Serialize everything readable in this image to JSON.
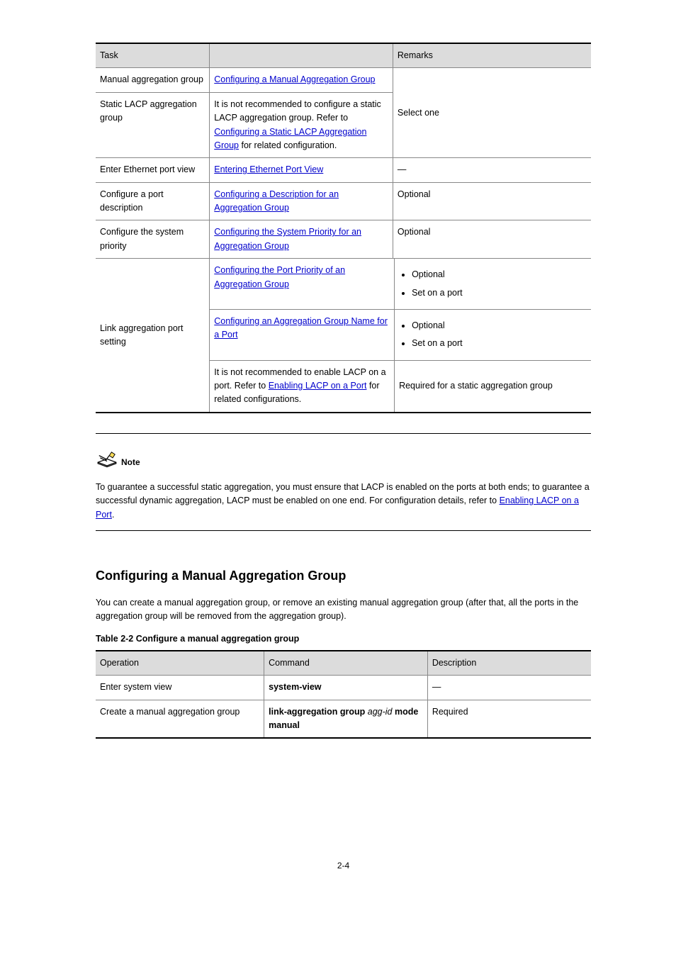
{
  "table1": {
    "headers": [
      "Task",
      "Remarks",
      ""
    ],
    "col_widths": [
      "23%",
      "37%",
      "40%"
    ],
    "rows": [
      {
        "task": "Manual aggregation group",
        "config_ref_text": "Configuring a Manual Aggregation Group",
        "after_link": "",
        "remarks": "Select one"
      },
      {
        "task": "Static LACP aggregation group",
        "pre": "It is not recommended to configure a static LACP aggregation group. Refer to ",
        "config_ref_text": "Configuring a Static LACP Aggregation Group",
        "after_link": " for related configuration.",
        "remarks": "Select one"
      },
      {
        "task": "Enter Ethernet port view",
        "config_ref_text": "Entering Ethernet Port View",
        "after_link": "",
        "remarks": "—"
      },
      {
        "task": "Configure a port description",
        "config_ref_text": "Configuring a Description for an Aggregation Group",
        "after_link": "",
        "remarks": "Optional"
      },
      {
        "task": "Configure the system priority",
        "config_ref_text": "Configuring the System Priority for an Aggregation Group",
        "after_link": "",
        "remarks": "Optional"
      },
      {
        "task_multiline": "Link aggregation port setting",
        "subrows": [
          {
            "config_ref_text": "Configuring the Port Priority of an Aggregation Group",
            "after_link": "",
            "bullets": [
              "Optional",
              "Set on a port"
            ]
          },
          {
            "config_ref_text": "Configuring an Aggregation Group Name for a Port",
            "after_link": "",
            "bullets": [
              "Optional",
              "Set on a port"
            ]
          },
          {
            "pre": "It is not recommended to enable LACP on a port. Refer to ",
            "config_ref_text": "Enabling LACP on a Port",
            "after_link": " for related configurations.",
            "remarks": "Required for a static aggregation group"
          }
        ]
      }
    ]
  },
  "note": {
    "label": "Note",
    "text_before": "To guarantee a successful static aggregation, you must ensure that LACP is enabled on the ports at both ends; to guarantee a successful dynamic aggregation, LACP must be enabled on one end. For configuration details, refer to ",
    "link_text": "Enabling LACP on a Port",
    "text_after": "."
  },
  "section": {
    "heading": "Configuring a Manual Aggregation Group",
    "para": "You can create a manual aggregation group, or remove an existing manual aggregation group (after that, all the ports in the aggregation group will be removed from the aggregation group).",
    "table_title": "Table 2-2",
    "table_title_rest": " Configure a manual aggregation group"
  },
  "table2": {
    "headers": [
      "Operation",
      "Command",
      "Description"
    ],
    "rows": [
      {
        "op": "Enter system view",
        "cmd": "system-view",
        "desc": "—"
      },
      {
        "op": "Create a manual aggregation group",
        "cmd_prefix": "link-aggregation group ",
        "cmd_arg": "agg-id",
        "cmd_suffix": " mode manual",
        "desc": "Required"
      }
    ]
  },
  "page_number": "2-4"
}
